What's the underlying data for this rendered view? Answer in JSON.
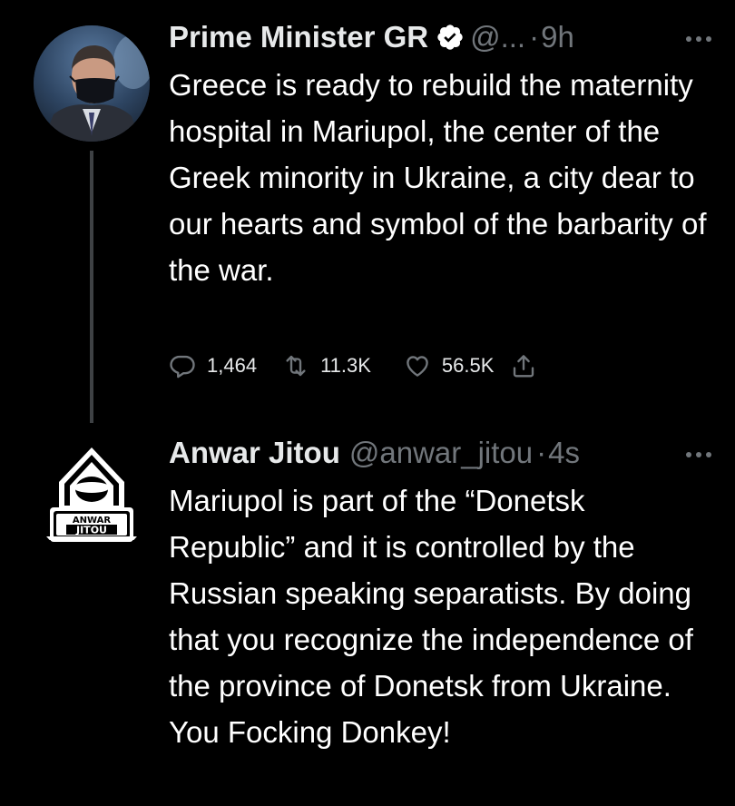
{
  "tweets": [
    {
      "author_name": "Prime Minister GR",
      "verified": true,
      "handle": "@...",
      "separator": "·",
      "time": "9h",
      "text": "Greece is ready to rebuild the maternity hospital in Mariupol, the center of the Greek minority in Ukraine, a city dear to our hearts and symbol of the barbarity of the war.",
      "stats": {
        "replies": "1,464",
        "retweets": "11.3K",
        "likes": "56.5K"
      },
      "avatar_icon": "portrait-photo-icon"
    },
    {
      "author_name": "Anwar Jitou",
      "verified": false,
      "handle": "@anwar_jitou",
      "separator": "·",
      "time": "4s",
      "text": "Mariupol is part of the “Donetsk Republic” and it is controlled by the Russian speaking separatists. By doing that you recognize the independence of the province of Donetsk from Ukraine. You Focking Donkey!",
      "avatar_logo_text": [
        "ANWAR",
        "JITOU"
      ],
      "avatar_icon": "hooded-figure-logo-icon"
    }
  ],
  "colors": {
    "background": "#000000",
    "primary_text": "#e7e9ea",
    "secondary_text": "#71767b",
    "thread_line": "#3e4144",
    "verified_badge": "#ffffff"
  },
  "icons": {
    "reply": "reply-icon",
    "retweet": "retweet-icon",
    "like": "heart-icon",
    "share": "share-icon",
    "more": "more-icon",
    "verified": "verified-badge-icon"
  }
}
